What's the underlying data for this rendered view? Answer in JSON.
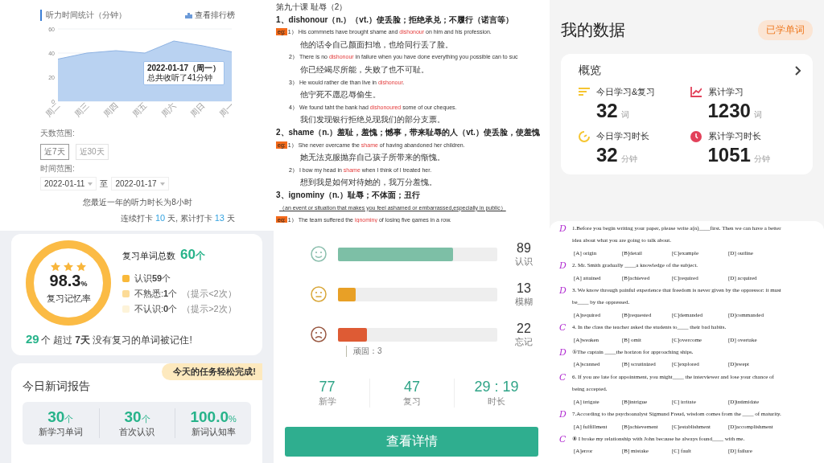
{
  "listening_panel": {
    "title": "听力时间统计（分钟）",
    "ranking_link": "查看排行榜",
    "chart_data": {
      "type": "area",
      "categories": [
        "周二",
        "周三",
        "周四",
        "周五",
        "周六",
        "周日",
        "周一"
      ],
      "series": [
        {
          "color": "#b9d2f1",
          "values": [
            35,
            40,
            42,
            40,
            50,
            46,
            41
          ]
        }
      ],
      "ylim": [
        0,
        60
      ],
      "yticks": [
        0,
        20,
        40,
        60
      ]
    },
    "tooltip": {
      "title": "2022-01-17（周一）",
      "text": "总共收听了41分钟"
    },
    "range_label": "天数范围:",
    "range_options": [
      {
        "label": "近7天",
        "selected": true
      },
      {
        "label": "近30天",
        "selected": false
      }
    ],
    "date_label": "时间范围:",
    "start_date": "2022-01-11",
    "date_separator": "至",
    "end_date": "2022-01-17",
    "summary": "您最近一年的听力时长为8小时",
    "streak": {
      "prefix": "连续打卡",
      "days": "10",
      "middle": "天, 累计打卡",
      "total": "13",
      "suffix": "天"
    }
  },
  "vocabulary_notes": {
    "title": "第九十课 耻辱（2）",
    "entries": [
      {
        "heading": "1、dishonour（n.）（vt.）使丢脸；拒绝承兑；不履行（诺言等）",
        "examples": [
          {
            "tag": "eg:",
            "number": "1）",
            "before": "His commnets have brought shame and ",
            "highlight": "dishonour",
            "after": " on him and his profession.",
            "translation": "他的话令自己颜面扫地，也给同行丢了脸。"
          },
          {
            "number": "2）",
            "before": "There is no ",
            "highlight": "dishonour",
            "after": " in failure when you have done everything you possible can to suc",
            "translation": "你已经竭尽所能，失败了也不可耻。"
          },
          {
            "number": "3）",
            "before": "He would rather die than live in ",
            "highlight": "dishonour",
            "after": ".",
            "translation": "他宁死不愿忍辱偷生。"
          },
          {
            "number": "4）",
            "before": "We found taht the bank had ",
            "highlight": "dishonoured",
            "after": " some of our cheques.",
            "translation": "我们发现银行拒绝兑现我们的部分支票。"
          }
        ]
      },
      {
        "heading": "2、shame（n.）羞耻，羞愧；憾事，带来耻辱的人（vt.）使丢脸，使羞愧",
        "examples": [
          {
            "tag": "eg:",
            "number": "1）",
            "before": "She never overcame the ",
            "highlight": "shame",
            "after": " of having abandoned her children.",
            "translation": "她无法克服抛弃自己孩子所带来的惭愧。"
          },
          {
            "number": "2）",
            "before": "I bow my head in ",
            "highlight": "shame",
            "after": " when I think of I treated her.",
            "translation": "想到我是如何对待她的，我万分羞愧。"
          }
        ]
      },
      {
        "heading": "3、ignominy（n.）耻辱；不体面；丑行",
        "definition": "（an event or situation that makes you feel ashamed or embarrassed,especially in public）",
        "examples": [
          {
            "tag": "eg:",
            "number": "1）",
            "before": "The team suffered the ",
            "highlight": "ignominy",
            "after": " of losing five games in a row."
          }
        ]
      }
    ]
  },
  "my_data": {
    "title": "我的数据",
    "badge": "已学单词",
    "card_title": "概览",
    "stats": [
      {
        "label": "今日学习&复习",
        "value": "32",
        "unit": "词"
      },
      {
        "label": "累计学习",
        "value": "1230",
        "unit": "词"
      },
      {
        "label": "今日学习时长",
        "value": "32",
        "unit": "分钟"
      },
      {
        "label": "累计学习时长",
        "value": "1051",
        "unit": "分钟"
      }
    ]
  },
  "review_report": {
    "stars": 3,
    "rate": "98.3",
    "rate_unit": "%",
    "rate_label": "复习记忆率",
    "total_label": "复习单词总数",
    "total": "60",
    "total_unit": "个",
    "legend": [
      {
        "label": "认识**59**个",
        "color": "#f9b93a"
      },
      {
        "label": "不熟悉:**1**个",
        "hint": "（提示<2次）",
        "color": "#fcdb97"
      },
      {
        "label": "不认识:**0**个",
        "hint": "（提示>2次）",
        "color": "#fdf3d9"
      }
    ],
    "retained_count": "29",
    "retained_text": "个 超过 **7天** 没有复习的单词被记住!",
    "task_badge": "今天的任务轻松完成!",
    "new_words_title": "今日新词报告",
    "new_words": [
      {
        "value": "30",
        "unit": "个",
        "label": "新学习单词"
      },
      {
        "value": "30",
        "unit": "个",
        "label": "首次认识"
      },
      {
        "value": "100.0",
        "unit": "%",
        "label": "新词认知率"
      }
    ]
  },
  "recall_stats": {
    "rows": [
      {
        "count": "89",
        "label": "认识",
        "level": 0.72,
        "color": "#7dbfa6"
      },
      {
        "count": "13",
        "label": "模糊",
        "level": 0.11,
        "color": "#e8a026"
      },
      {
        "count": "22",
        "label": "忘记",
        "level": 0.18,
        "color": "#de5b34",
        "note": "顽固：3"
      }
    ],
    "totals": [
      {
        "value": "77",
        "label": "新学"
      },
      {
        "value": "47",
        "label": "复习"
      },
      {
        "value": "29 : 19",
        "label": "时长"
      }
    ],
    "button": "查看详情"
  },
  "exam_sheet": {
    "lines": [
      {
        "kind": "text",
        "answer": "D",
        "text": "1.Before you begin writing your paper, please write a(n)____first. Then we can have a better"
      },
      {
        "kind": "text",
        "text": "idea about what you are going to talk about."
      },
      {
        "kind": "options",
        "options": [
          "[A] origin",
          "[B]detail",
          "[C]example",
          "[D] outline"
        ]
      },
      {
        "kind": "text",
        "answer": "D",
        "text": "2. Mr. Smith gradually ____a knowledge of the subject."
      },
      {
        "kind": "options",
        "options": [
          "[A] attained",
          "[B]achieved",
          "[C]required",
          "[D] acquired"
        ]
      },
      {
        "kind": "text",
        "answer": "D",
        "text": "3. We know through painful experience that freedom is never given by the oppressor: it must"
      },
      {
        "kind": "text",
        "text": "be____ by the oppressed."
      },
      {
        "kind": "options",
        "options": [
          "[A]required",
          "[B]requested",
          "[C]demanded",
          "[D]commanded"
        ]
      },
      {
        "kind": "text",
        "answer": "C",
        "text": "4. In the class the teacher asked the students to____ their bad habits."
      },
      {
        "kind": "options",
        "options": [
          "[A]weaken",
          "[B] omit",
          "[C]overcome",
          "[D] overtake"
        ]
      },
      {
        "kind": "text",
        "answer": "D",
        "text": "⑤The captain ____the horizon for approaching ships."
      },
      {
        "kind": "options",
        "options": [
          "[A]scanned",
          "[B] scrutinized",
          "[C]explored",
          "[D]swept"
        ]
      },
      {
        "kind": "text",
        "answer": "C",
        "text": "6. If you are late for appointment, you might____ the interviewer and lose your chance of"
      },
      {
        "kind": "text",
        "text": "being accepted."
      },
      {
        "kind": "options",
        "options": [
          "[A] irrigate",
          "[B]intrigue",
          "[C] irritate",
          "[D]intimidate"
        ]
      },
      {
        "kind": "text",
        "answer": "D",
        "text": "7.According to the psychoanalyst Sigmund Freud, wisdom comes from the ____ of maturity."
      },
      {
        "kind": "options",
        "options": [
          "[A] fulfillment",
          "[B]achievement",
          "[C]establishment",
          "[D]accomplishment"
        ]
      },
      {
        "kind": "text",
        "answer": "C",
        "text": "⑧ I broke my relationship with John because he always found____ with me."
      },
      {
        "kind": "options",
        "options": [
          "[A]error",
          "[B] mistake",
          "[C] fault",
          "[D] failure"
        ]
      }
    ]
  }
}
